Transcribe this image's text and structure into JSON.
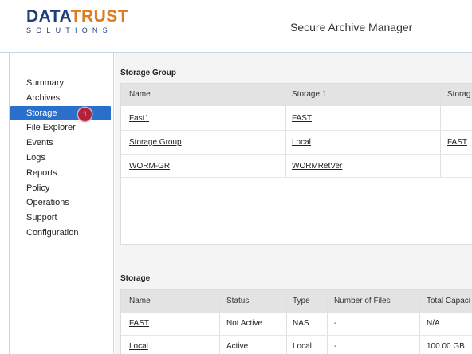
{
  "brand": {
    "logo_part1": "DATA",
    "logo_part2": "TRUST",
    "logo_sub": "SOLUTIONS",
    "primary_color": "#1e3f7a",
    "accent_color": "#e07a1f"
  },
  "header": {
    "title": "Secure Archive Manager"
  },
  "sidebar": {
    "active_color": "#2a6fca",
    "items": [
      {
        "label": "Summary"
      },
      {
        "label": "Archives"
      },
      {
        "label": "Storage",
        "active": true,
        "badge": "1"
      },
      {
        "label": "File Explorer"
      },
      {
        "label": "Events"
      },
      {
        "label": "Logs"
      },
      {
        "label": "Reports"
      },
      {
        "label": "Policy"
      },
      {
        "label": "Operations"
      },
      {
        "label": "Support"
      },
      {
        "label": "Configuration"
      }
    ]
  },
  "storage_group": {
    "title": "Storage Group",
    "columns": [
      "Name",
      "Storage 1",
      "Storag"
    ],
    "rows": [
      [
        "Fast1",
        "FAST",
        ""
      ],
      [
        "Storage Group",
        "Local",
        "FAST"
      ],
      [
        "WORM-GR",
        "WORMRetVer",
        ""
      ]
    ]
  },
  "storage": {
    "title": "Storage",
    "columns": [
      "Name",
      "Status",
      "Type",
      "Number of Files",
      "Total Capaci"
    ],
    "rows": [
      [
        "FAST",
        "Not Active",
        "NAS",
        "-",
        "N/A"
      ],
      [
        "Local",
        "Active",
        "Local",
        "-",
        "100.00 GB"
      ]
    ]
  }
}
